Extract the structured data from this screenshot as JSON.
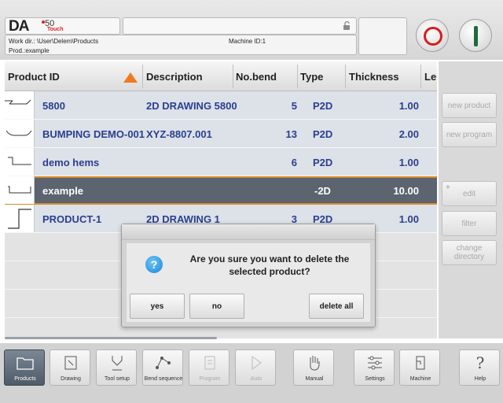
{
  "header": {
    "logo": {
      "brand": "DA",
      "model": "50",
      "suffix": "Touch"
    },
    "work_dir": "Work dir.: \\User\\Delem\\Products",
    "machine_id": "Machine ID:1",
    "product": "Prod.:example",
    "lock_icon": "lock-icon",
    "colors": {
      "stop": "#d81c1c",
      "start": "#1f6a3a"
    }
  },
  "table": {
    "columns": [
      "Product ID",
      "Description",
      "No.bend",
      "Type",
      "Thickness",
      "Le"
    ],
    "sorted_by": "Product ID",
    "sort_color": "#f07a20",
    "rows": [
      {
        "id": "5800",
        "description": "2D DRAWING 5800",
        "bends": "5",
        "type": "P2D",
        "thickness": "1.00",
        "selected": false
      },
      {
        "id": "BUMPING DEMO-001",
        "description": "XYZ-8807.001",
        "bends": "13",
        "type": "P2D",
        "thickness": "2.00",
        "selected": false
      },
      {
        "id": "demo hems",
        "description": "",
        "bends": "6",
        "type": "P2D",
        "thickness": "1.00",
        "selected": false
      },
      {
        "id": "example",
        "description": "",
        "bends": "",
        "type": "-2D",
        "thickness": "10.00",
        "selected": true
      },
      {
        "id": "PRODUCT-1",
        "description": "2D DRAWING 1",
        "bends": "3",
        "type": "P2D",
        "thickness": "1.00",
        "selected": false
      }
    ],
    "selected_color": "#5c6470",
    "accent_color": "#d78b2c"
  },
  "sidebar": {
    "new_product": "new product",
    "new_program": "new program",
    "edit": "edit",
    "filter": "filter",
    "change_directory": "change directory"
  },
  "dialog": {
    "message": "Are you sure you want to delete the selected product?",
    "icon": "question-icon",
    "yes": "yes",
    "no": "no",
    "delete_all": "delete all"
  },
  "bottom_nav": [
    {
      "label": "Products",
      "icon": "folder-icon",
      "active": true,
      "enabled": true
    },
    {
      "label": "Drawing",
      "icon": "drawing-icon",
      "active": false,
      "enabled": true
    },
    {
      "label": "Tool setup",
      "icon": "tool-icon",
      "active": false,
      "enabled": true
    },
    {
      "label": "Bend sequence",
      "icon": "bend-sequence-icon",
      "active": false,
      "enabled": true
    },
    {
      "label": "Program",
      "icon": "program-icon",
      "active": false,
      "enabled": false
    },
    {
      "label": "Auto",
      "icon": "play-icon",
      "active": false,
      "enabled": false
    },
    {
      "label": "Manual",
      "icon": "hand-icon",
      "active": false,
      "enabled": true
    },
    {
      "label": "Settings",
      "icon": "settings-icon",
      "active": false,
      "enabled": true
    },
    {
      "label": "Machine",
      "icon": "machine-icon",
      "active": false,
      "enabled": true
    },
    {
      "label": "Help",
      "icon": "help-icon",
      "active": false,
      "enabled": true
    }
  ]
}
